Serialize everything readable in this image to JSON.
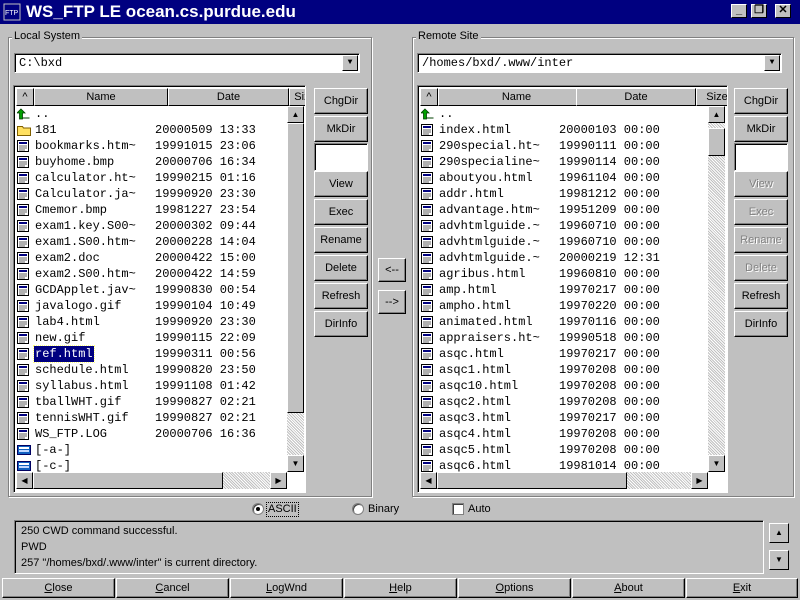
{
  "window": {
    "title": "WS_FTP LE ocean.cs.purdue.edu",
    "icon_label": "FTP"
  },
  "local": {
    "group_label": "Local System",
    "path": "C:\\bxd",
    "columns": {
      "sort": "^",
      "name": "Name",
      "date": "Date",
      "size": "Size"
    },
    "files": [
      {
        "icon": "up-folder-icon",
        "name": "..",
        "date": ""
      },
      {
        "icon": "folder-icon",
        "name": "181",
        "date": "20000509 13:33"
      },
      {
        "icon": "file-icon",
        "name": "bookmarks.htm~",
        "date": "19991015 23:06"
      },
      {
        "icon": "file-icon",
        "name": "buyhome.bmp",
        "date": "20000706 16:34"
      },
      {
        "icon": "file-icon",
        "name": "calculator.ht~",
        "date": "19990215 01:16"
      },
      {
        "icon": "file-icon",
        "name": "Calculator.ja~",
        "date": "19990920 23:30"
      },
      {
        "icon": "file-icon",
        "name": "Cmemor.bmp",
        "date": "19981227 23:54"
      },
      {
        "icon": "file-icon",
        "name": "exam1.key.S00~",
        "date": "20000302 09:44"
      },
      {
        "icon": "file-icon",
        "name": "exam1.S00.htm~",
        "date": "20000228 14:04"
      },
      {
        "icon": "file-icon",
        "name": "exam2.doc",
        "date": "20000422 15:00"
      },
      {
        "icon": "file-icon",
        "name": "exam2.S00.htm~",
        "date": "20000422 14:59"
      },
      {
        "icon": "file-icon",
        "name": "GCDApplet.jav~",
        "date": "19990830 00:54"
      },
      {
        "icon": "file-icon",
        "name": "javalogo.gif",
        "date": "19990104 10:49"
      },
      {
        "icon": "file-icon",
        "name": "lab4.html",
        "date": "19990920 23:30"
      },
      {
        "icon": "file-icon",
        "name": "new.gif",
        "date": "19990115 22:09"
      },
      {
        "icon": "file-icon",
        "name": "ref.html",
        "date": "19990311 00:56",
        "selected": true
      },
      {
        "icon": "file-icon",
        "name": "schedule.html",
        "date": "19990820 23:50"
      },
      {
        "icon": "file-icon",
        "name": "syllabus.html",
        "date": "19991108 01:42"
      },
      {
        "icon": "file-icon",
        "name": "tballWHT.gif",
        "date": "19990827 02:21"
      },
      {
        "icon": "file-icon",
        "name": "tennisWHT.gif",
        "date": "19990827 02:21"
      },
      {
        "icon": "file-icon",
        "name": "WS_FTP.LOG",
        "date": "20000706 16:36"
      },
      {
        "icon": "drive-icon",
        "name": "[-a-]",
        "date": ""
      },
      {
        "icon": "drive-icon",
        "name": "[-c-]",
        "date": ""
      }
    ],
    "buttons": [
      {
        "label": "ChgDir",
        "enabled": true
      },
      {
        "label": "MkDir",
        "enabled": true
      },
      {
        "label": "View",
        "enabled": true
      },
      {
        "label": "Exec",
        "enabled": true
      },
      {
        "label": "Rename",
        "enabled": true
      },
      {
        "label": "Delete",
        "enabled": true
      },
      {
        "label": "Refresh",
        "enabled": true
      },
      {
        "label": "DirInfo",
        "enabled": true
      }
    ]
  },
  "remote": {
    "group_label": "Remote Site",
    "path": "/homes/bxd/.www/inter",
    "columns": {
      "sort": "^",
      "name": "Name",
      "date": "Date",
      "size": "Size"
    },
    "files": [
      {
        "icon": "up-folder-icon",
        "name": "..",
        "date": ""
      },
      {
        "icon": "file-icon",
        "name": "index.html",
        "date": "20000103 00:00"
      },
      {
        "icon": "file-icon",
        "name": "290special.ht~",
        "date": "19990111 00:00"
      },
      {
        "icon": "file-icon",
        "name": "290specialine~",
        "date": "19990114 00:00"
      },
      {
        "icon": "file-icon",
        "name": "aboutyou.html",
        "date": "19961104 00:00"
      },
      {
        "icon": "file-icon",
        "name": "addr.html",
        "date": "19981212 00:00"
      },
      {
        "icon": "file-icon",
        "name": "advantage.htm~",
        "date": "19951209 00:00"
      },
      {
        "icon": "file-icon",
        "name": "advhtmlguide.~",
        "date": "19960710 00:00"
      },
      {
        "icon": "file-icon",
        "name": "advhtmlguide.~",
        "date": "19960710 00:00"
      },
      {
        "icon": "file-icon",
        "name": "advhtmlguide.~",
        "date": "20000219 12:31"
      },
      {
        "icon": "file-icon",
        "name": "agribus.html",
        "date": "19960810 00:00"
      },
      {
        "icon": "file-icon",
        "name": "amp.html",
        "date": "19970217 00:00"
      },
      {
        "icon": "file-icon",
        "name": "ampho.html",
        "date": "19970220 00:00"
      },
      {
        "icon": "file-icon",
        "name": "animated.html",
        "date": "19970116 00:00"
      },
      {
        "icon": "file-icon",
        "name": "appraisers.ht~",
        "date": "19990518 00:00"
      },
      {
        "icon": "file-icon",
        "name": "asqc.html",
        "date": "19970217 00:00"
      },
      {
        "icon": "file-icon",
        "name": "asqc1.html",
        "date": "19970208 00:00"
      },
      {
        "icon": "file-icon",
        "name": "asqc10.html",
        "date": "19970208 00:00"
      },
      {
        "icon": "file-icon",
        "name": "asqc2.html",
        "date": "19970208 00:00"
      },
      {
        "icon": "file-icon",
        "name": "asqc3.html",
        "date": "19970217 00:00"
      },
      {
        "icon": "file-icon",
        "name": "asqc4.html",
        "date": "19970208 00:00"
      },
      {
        "icon": "file-icon",
        "name": "asqc5.html",
        "date": "19970208 00:00"
      },
      {
        "icon": "file-icon",
        "name": "asqc6.html",
        "date": "19981014 00:00"
      }
    ],
    "buttons": [
      {
        "label": "ChgDir",
        "enabled": true
      },
      {
        "label": "MkDir",
        "enabled": true
      },
      {
        "label": "View",
        "enabled": false
      },
      {
        "label": "Exec",
        "enabled": false
      },
      {
        "label": "Rename",
        "enabled": false
      },
      {
        "label": "Delete",
        "enabled": false
      },
      {
        "label": "Refresh",
        "enabled": true
      },
      {
        "label": "DirInfo",
        "enabled": true
      }
    ]
  },
  "transfer": {
    "download_label": "<--",
    "upload_label": "-->"
  },
  "mode": {
    "ascii_label": "ASCII",
    "binary_label": "Binary",
    "auto_label": "Auto",
    "selected": "ASCII",
    "auto_checked": false
  },
  "log": {
    "lines": [
      "250 CWD command successful.",
      "PWD",
      "257 \"/homes/bxd/.www/inter\" is current directory."
    ]
  },
  "bottom_buttons": [
    {
      "name": "close-button",
      "label": "Close",
      "accel": "C",
      "rest": "lose"
    },
    {
      "name": "cancel-button",
      "label": "Cancel",
      "accel": "C",
      "rest": "ancel"
    },
    {
      "name": "logwnd-button",
      "label": "LogWnd",
      "accel": "L",
      "rest": "ogWnd"
    },
    {
      "name": "help-button",
      "label": "Help",
      "accel": "H",
      "rest": "elp"
    },
    {
      "name": "options-button",
      "label": "Options",
      "accel": "O",
      "rest": "ptions"
    },
    {
      "name": "about-button",
      "label": "About",
      "accel": "A",
      "rest": "bout"
    },
    {
      "name": "exit-button",
      "label": "Exit",
      "accel": "E",
      "rest": "xit"
    }
  ],
  "colors": {
    "titlebar": "#000080",
    "face": "#c0c0c0",
    "selection": "#000080"
  }
}
